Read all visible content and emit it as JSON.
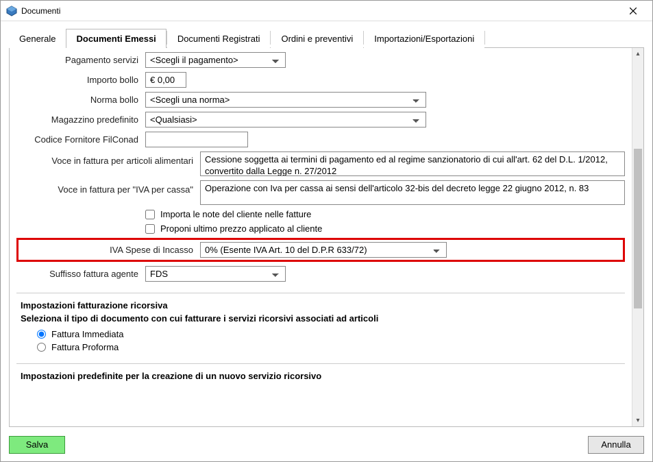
{
  "window": {
    "title": "Documenti"
  },
  "tabs": {
    "generale": "Generale",
    "emessi": "Documenti Emessi",
    "registrati": "Documenti Registrati",
    "ordini": "Ordini e preventivi",
    "import": "Importazioni/Esportazioni"
  },
  "fields": {
    "pagamento_servizi": {
      "label": "Pagamento servizi",
      "value": "<Scegli il pagamento>"
    },
    "importo_bollo": {
      "label": "Importo bollo",
      "value": "€ 0,00"
    },
    "norma_bollo": {
      "label": "Norma bollo",
      "value": "<Scegli una norma>"
    },
    "magazzino_predefinito": {
      "label": "Magazzino predefinito",
      "value": "<Qualsiasi>"
    },
    "codice_filconad": {
      "label": "Codice Fornitore FilConad",
      "value": ""
    },
    "voce_alimentari": {
      "label": "Voce in fattura per articoli alimentari",
      "value": "Cessione soggetta ai termini di pagamento ed al regime sanzionatorio di cui all'art. 62 del D.L. 1/2012, convertito dalla Legge n. 27/2012"
    },
    "voce_iva_cassa": {
      "label": "Voce in fattura per \"IVA per cassa\"",
      "value": "Operazione con Iva per cassa ai sensi dell'articolo 32-bis del decreto legge 22 giugno 2012, n. 83"
    },
    "chk_importa_note": {
      "label": "Importa le note del cliente nelle fatture"
    },
    "chk_ultimo_prezzo": {
      "label": "Proponi ultimo prezzo applicato al cliente"
    },
    "iva_spese_incasso": {
      "label": "IVA Spese di Incasso",
      "value": "0% (Esente IVA Art. 10 del D.P.R 633/72)"
    },
    "suffisso_agente": {
      "label": "Suffisso fattura agente",
      "value": "FDS"
    }
  },
  "section_ricorsiva": {
    "title": "Impostazioni fatturazione ricorsiva",
    "subtitle": "Seleziona il tipo di documento con cui fatturare i servizi ricorsivi associati ad articoli",
    "opt_immediata": "Fattura Immediata",
    "opt_proforma": "Fattura Proforma"
  },
  "section_predefinite": {
    "title": "Impostazioni predefinite per la creazione di un nuovo servizio ricorsivo"
  },
  "footer": {
    "save": "Salva",
    "cancel": "Annulla"
  }
}
